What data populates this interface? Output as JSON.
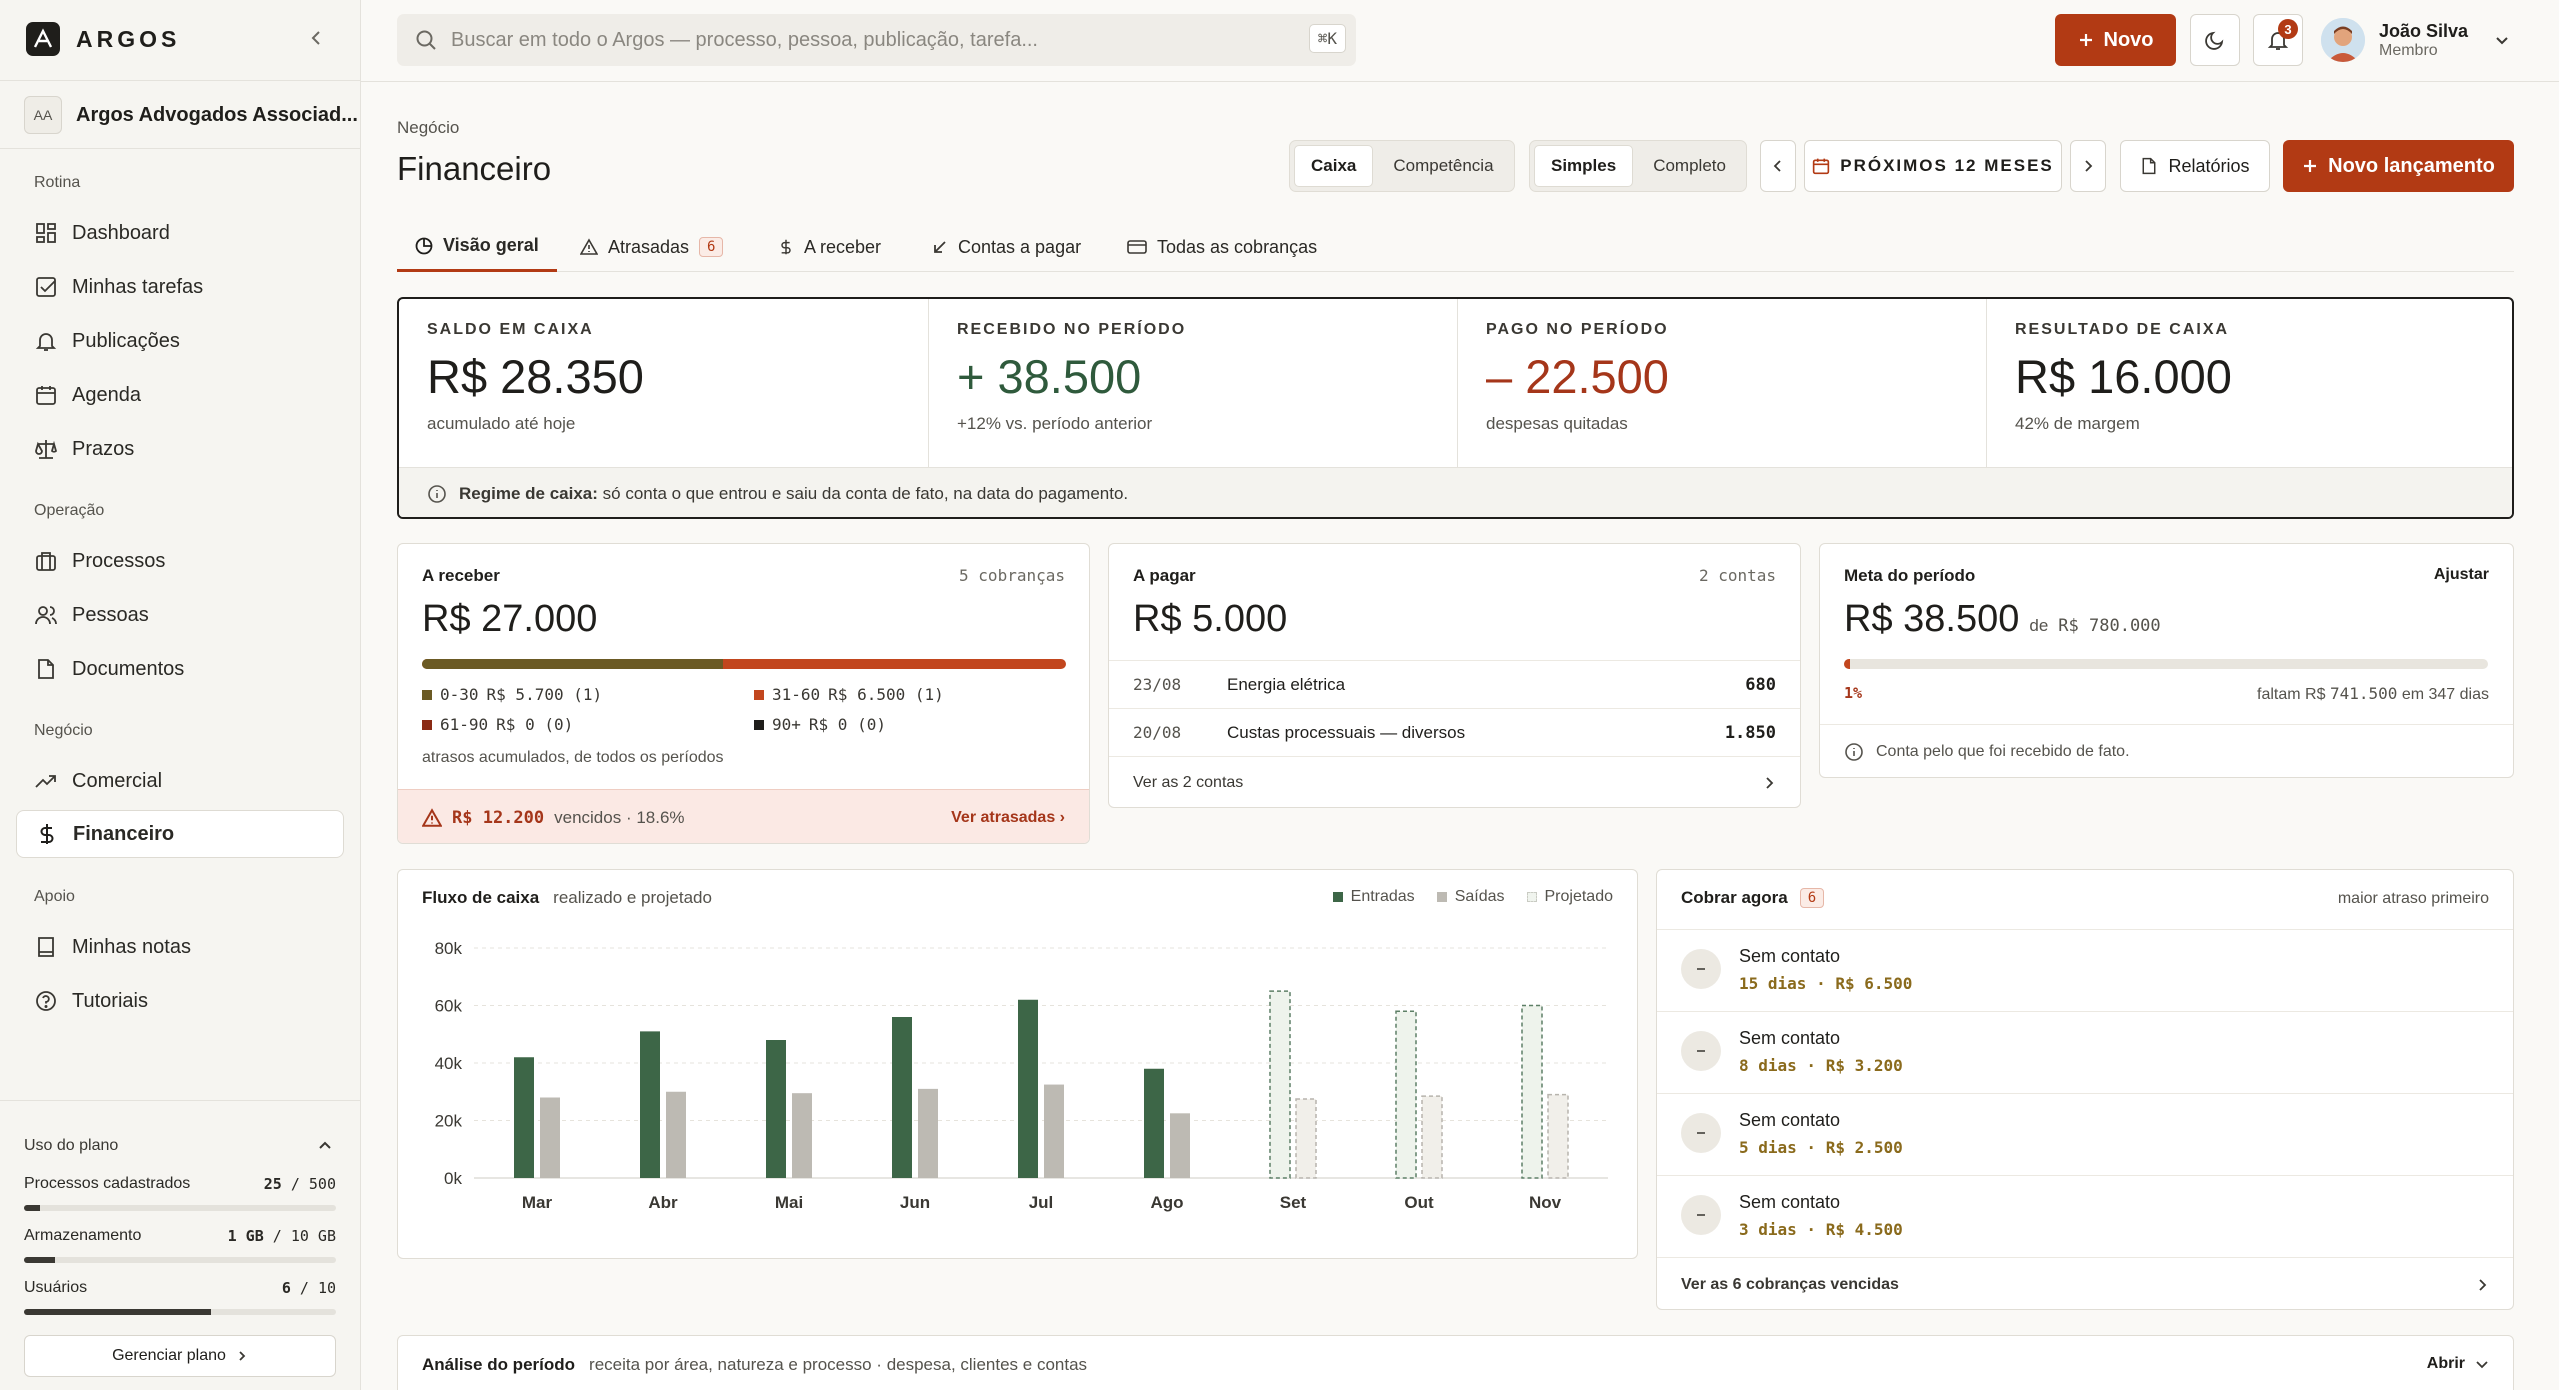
{
  "brand": {
    "name": "ARGOS"
  },
  "org": {
    "initials": "AA",
    "name": "Argos Advogados Associad..."
  },
  "nav": {
    "sections": [
      {
        "title": "Rotina",
        "items": [
          "Dashboard",
          "Minhas tarefas",
          "Publicações",
          "Agenda",
          "Prazos"
        ]
      },
      {
        "title": "Operação",
        "items": [
          "Processos",
          "Pessoas",
          "Documentos"
        ]
      },
      {
        "title": "Negócio",
        "items": [
          "Comercial",
          "Financeiro"
        ]
      },
      {
        "title": "Apoio",
        "items": [
          "Minhas notas",
          "Tutoriais"
        ]
      }
    ],
    "active": "Financeiro"
  },
  "plan": {
    "title": "Uso do plano",
    "rows": [
      {
        "label": "Processos cadastrados",
        "used": "25",
        "sep": "/",
        "total": "500",
        "fraction": 0.05
      },
      {
        "label": "Armazenamento",
        "used": "1 GB",
        "sep": "/",
        "total": "10 GB",
        "fraction": 0.1
      },
      {
        "label": "Usuários",
        "used": "6",
        "sep": "/",
        "total": "10",
        "fraction": 0.6
      }
    ],
    "button": "Gerenciar plano"
  },
  "topbar": {
    "search_placeholder": "Buscar em todo o Argos — processo, pessoa, publicação, tarefa...",
    "shortcut": "⌘K",
    "new_label": "Novo",
    "notifications": "3",
    "user_name": "João Silva",
    "user_role": "Membro"
  },
  "page": {
    "breadcrumb": "Negócio",
    "title": "Financeiro",
    "regime": [
      "Caixa",
      "Competência"
    ],
    "regime_active": "Caixa",
    "detail": [
      "Simples",
      "Completo"
    ],
    "detail_active": "Simples",
    "period": "PRÓXIMOS 12 MESES",
    "reports": "Relatórios",
    "add": "Novo lançamento"
  },
  "tabs": [
    {
      "label": "Visão geral",
      "count": ""
    },
    {
      "label": "Atrasadas",
      "count": "6"
    },
    {
      "label": "A receber",
      "count": ""
    },
    {
      "label": "Contas a pagar",
      "count": ""
    },
    {
      "label": "Todas as cobranças",
      "count": ""
    }
  ],
  "kpis": [
    {
      "label": "SALDO EM CAIXA",
      "value": "R$ 28.350",
      "sub": "acumulado até hoje",
      "color": "#1f1e1b"
    },
    {
      "label": "RECEBIDO NO PERÍODO",
      "value": "+ 38.500",
      "sub": "+12% vs. período anterior",
      "color": "#2f5a3c"
    },
    {
      "label": "PAGO NO PERÍODO",
      "value": "– 22.500",
      "sub": "despesas quitadas",
      "color": "#a5361a"
    },
    {
      "label": "RESULTADO DE CAIXA",
      "value": "R$ 16.000",
      "sub": "42% de margem",
      "color": "#1f1e1b"
    }
  ],
  "kpi_note": {
    "bold": "Regime de caixa:",
    "text": "só conta o que entrou e saiu da conta de fato, na data do pagamento."
  },
  "receber": {
    "title": "A receber",
    "count": "5 cobranças",
    "value": "R$ 27.000",
    "buckets": [
      {
        "label": "0-30",
        "value": "R$ 5.700 (1)",
        "color": "#6b5a24"
      },
      {
        "label": "31-60",
        "value": "R$ 6.500 (1)",
        "color": "#c2461e"
      },
      {
        "label": "61-90",
        "value": "R$ 0 (0)",
        "color": "#8a2a14"
      },
      {
        "label": "90+",
        "value": "R$ 0 (0)",
        "color": "#1f1e1b"
      }
    ],
    "bar_fraction": 0.467,
    "note": "atrasos acumulados, de todos os períodos",
    "alert_value": "R$ 12.200",
    "alert_text": "vencidos · 18.6%",
    "alert_link": "Ver atrasadas ›"
  },
  "pagar": {
    "title": "A pagar",
    "count": "2 contas",
    "value": "R$ 5.000",
    "rows": [
      {
        "date": "23/08",
        "desc": "Energia elétrica",
        "amount": "680"
      },
      {
        "date": "20/08",
        "desc": "Custas processuais — diversos",
        "amount": "1.850"
      }
    ],
    "link": "Ver as 2 contas"
  },
  "meta": {
    "title": "Meta do período",
    "action": "Ajustar",
    "value": "R$ 38.500",
    "of": "de",
    "target": "R$ 780.000",
    "pct": "1%",
    "fraction": 0.01,
    "remaining_prefix": "faltam R$",
    "remaining": "741.500",
    "remaining_suffix": "em 347 dias",
    "note": "Conta pelo que foi recebido de fato."
  },
  "chart_data": {
    "type": "bar",
    "title": "Fluxo de caixa",
    "subtitle": "realizado e projetado",
    "categories": [
      "Mar",
      "Abr",
      "Mai",
      "Jun",
      "Jul",
      "Ago",
      "Set",
      "Out",
      "Nov"
    ],
    "series": [
      {
        "name": "Entradas",
        "values": [
          42000,
          51000,
          48000,
          56000,
          62000,
          38000,
          65000,
          58000,
          60000
        ],
        "color": "#3d6647"
      },
      {
        "name": "Saídas",
        "values": [
          28000,
          30000,
          29500,
          31000,
          32500,
          22500,
          27500,
          28500,
          29000
        ],
        "color": "#bdbab3"
      }
    ],
    "projected_from": "Set",
    "legend": [
      "Entradas",
      "Saídas",
      "Projetado"
    ],
    "yticks": [
      "80k",
      "60k",
      "40k",
      "20k",
      "0k"
    ],
    "ylim": [
      0,
      80000
    ],
    "grid": true,
    "legend_position": "top-right"
  },
  "cobrar": {
    "title": "Cobrar agora",
    "count": "6",
    "sort": "maior atraso primeiro",
    "rows": [
      {
        "name": "Sem contato",
        "detail": "15 dias · R$ 6.500"
      },
      {
        "name": "Sem contato",
        "detail": "8 dias · R$ 3.200"
      },
      {
        "name": "Sem contato",
        "detail": "5 dias · R$ 2.500"
      },
      {
        "name": "Sem contato",
        "detail": "3 dias · R$ 4.500"
      }
    ],
    "link": "Ver as 6 cobranças vencidas"
  },
  "analise": {
    "title": "Análise do período",
    "subtitle": "receita por área, natureza e processo · despesa, clientes e contas",
    "action": "Abrir"
  }
}
